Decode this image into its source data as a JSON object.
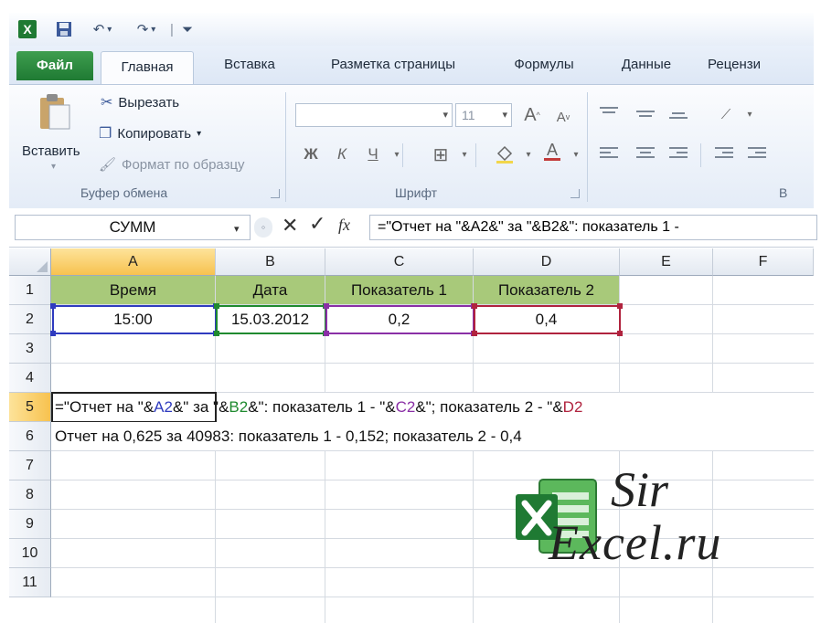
{
  "quick_access": {
    "app_icon": "excel-x-icon",
    "save": "save-icon",
    "undo": "undo-icon",
    "redo": "redo-icon",
    "customize": "customize-icon"
  },
  "tabs": [
    {
      "label": "Файл",
      "type": "file"
    },
    {
      "label": "Главная",
      "type": "active"
    },
    {
      "label": "Вставка"
    },
    {
      "label": "Разметка страницы"
    },
    {
      "label": "Формулы"
    },
    {
      "label": "Данные"
    },
    {
      "label": "Рецензи"
    }
  ],
  "ribbon": {
    "clipboard": {
      "paste_label": "Вставить",
      "cut_label": "Вырезать",
      "copy_label": "Копировать",
      "format_painter_label": "Формат по образцу",
      "group_label": "Буфер обмена"
    },
    "font": {
      "font_name": "",
      "font_size": "11",
      "bold": "Ж",
      "italic": "К",
      "underline": "Ч",
      "group_label": "Шрифт"
    },
    "partial_group_label": "В"
  },
  "formula_bar": {
    "name_box": "СУММ",
    "formula": "=\"Отчет на \"&A2&\" за \"&B2&\": показатель 1 - "
  },
  "grid": {
    "columns": [
      "A",
      "B",
      "C",
      "D",
      "E",
      "F"
    ],
    "rows": [
      "1",
      "2",
      "3",
      "4",
      "5",
      "6",
      "7",
      "8",
      "9",
      "10",
      "11"
    ],
    "row1": [
      "Время",
      "Дата",
      "Показатель 1",
      "Показатель 2"
    ],
    "row2": [
      "15:00",
      "15.03.2012",
      "0,2",
      "0,4"
    ],
    "row5_parts": [
      "=\"Отчет на \"&",
      "A2",
      "&\" за \"&",
      "B2",
      "&\": показатель 1 - \"&",
      "C2",
      "&\"; показатель 2 - \"&",
      "D2"
    ],
    "row6": "Отчет на 0,625 за 40983: показатель 1 - 0,152; показатель 2 - 0,4"
  },
  "colors": {
    "header_fill": "#a8c97a",
    "ref_a": "#2f3bbf",
    "ref_b": "#1f8a2f",
    "ref_c": "#8a2fa6",
    "ref_d": "#b0233e",
    "selected_header": "#f7c24f"
  },
  "watermark": {
    "line1": "Sir",
    "line2": "Excel.ru",
    "icon": "excel-logo-icon"
  }
}
